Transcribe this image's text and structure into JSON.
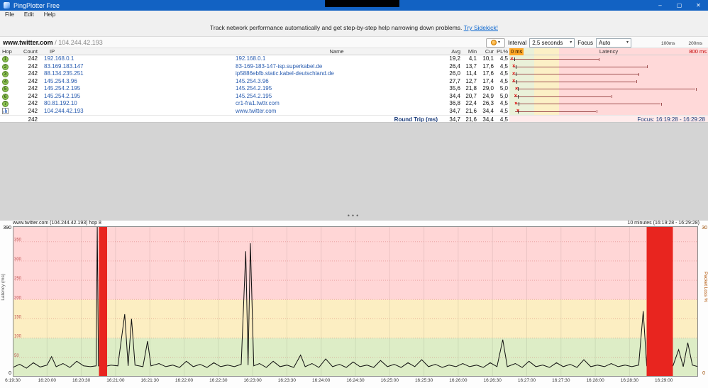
{
  "window": {
    "title": "PingPlotter Free",
    "menu": [
      "File",
      "Edit",
      "Help"
    ],
    "buttons": {
      "minimize": "–",
      "maximize": "▢",
      "close": "✕"
    }
  },
  "banner": {
    "text": "Track network performance automatically and get step-by-step help narrowing down problems.",
    "link": "Try Sidekick!"
  },
  "target": {
    "host": "www.twitter.com",
    "separator": "/",
    "ip": "104.244.42.193"
  },
  "controls": {
    "dropdown_glyph": "▾",
    "interval_label": "Interval",
    "interval_value": "2,5 seconds",
    "focus_label": "Focus",
    "focus_value": "Auto",
    "legend": {
      "label_100": "100ms",
      "label_200": "200ms"
    }
  },
  "table": {
    "x_marker": "×",
    "headers": {
      "hop": "Hop",
      "count": "Count",
      "ip": "IP",
      "name": "Name",
      "avg": "Avg",
      "min": "Min",
      "cur": "Cur",
      "pl": "PL%",
      "latency": "Latency",
      "scale_min": "0 ms",
      "scale_max": "800 ms"
    },
    "scale_max_ms": 800,
    "rows": [
      {
        "hop": "1",
        "count": "242",
        "ip": "192.168.0.1",
        "name": "192.168.0.1",
        "avg": "19,2",
        "min": "4,1",
        "cur": "10,1",
        "pl": "4,5",
        "min_ms": 4.1,
        "avg_ms": 19.2,
        "cur_ms": 10.1,
        "max_ms": 360
      },
      {
        "hop": "2",
        "count": "242",
        "ip": "83.169.183.147",
        "name": "83-169-183-147-isp.superkabel.de",
        "avg": "26,4",
        "min": "13,7",
        "cur": "17,6",
        "pl": "4,5",
        "min_ms": 13.7,
        "avg_ms": 26.4,
        "cur_ms": 17.6,
        "max_ms": 555
      },
      {
        "hop": "3",
        "count": "242",
        "ip": "88.134.235.251",
        "name": "ip5886ebfb.static.kabel-deutschland.de",
        "avg": "26,0",
        "min": "11,4",
        "cur": "17,6",
        "pl": "4,5",
        "min_ms": 11.4,
        "avg_ms": 26.0,
        "cur_ms": 17.6,
        "max_ms": 520
      },
      {
        "hop": "4",
        "count": "242",
        "ip": "145.254.3.96",
        "name": "145.254.3.96",
        "avg": "27,7",
        "min": "12,7",
        "cur": "17,4",
        "pl": "4,5",
        "min_ms": 12.7,
        "avg_ms": 27.7,
        "cur_ms": 17.4,
        "max_ms": 510
      },
      {
        "hop": "5",
        "count": "242",
        "ip": "145.254.2.195",
        "name": "145.254.2.195",
        "avg": "35,6",
        "min": "21,8",
        "cur": "29,0",
        "pl": "5,0",
        "min_ms": 21.8,
        "avg_ms": 35.6,
        "cur_ms": 29.0,
        "max_ms": 750
      },
      {
        "hop": "6",
        "count": "242",
        "ip": "145.254.2.195",
        "name": "145.254.2.195",
        "avg": "34,4",
        "min": "20,7",
        "cur": "24,9",
        "pl": "5,0",
        "min_ms": 20.7,
        "avg_ms": 34.4,
        "cur_ms": 24.9,
        "max_ms": 410
      },
      {
        "hop": "7",
        "count": "242",
        "ip": "80.81.192.10",
        "name": "cr1-fra1.twttr.com",
        "avg": "36,8",
        "min": "22,4",
        "cur": "26,3",
        "pl": "4,5",
        "min_ms": 22.4,
        "avg_ms": 36.8,
        "cur_ms": 26.3,
        "max_ms": 610
      },
      {
        "hop": "8",
        "count": "242",
        "ip": "104.244.42.193",
        "name": "www.twitter.com",
        "avg": "34,7",
        "min": "21,6",
        "cur": "34,4",
        "pl": "4,5",
        "min_ms": 21.6,
        "avg_ms": 34.7,
        "cur_ms": 34.4,
        "max_ms": 350,
        "icon": "graph"
      }
    ],
    "summary": {
      "count": "242",
      "label": "Round Trip (ms)",
      "avg": "34,7",
      "min": "21,6",
      "cur": "34,4",
      "pl": "4,5"
    },
    "focus_text": "Focus: 16:19:28 - 16:29:28"
  },
  "splitter": {
    "glyph": "•••"
  },
  "timeline": {
    "title_left": "www.twitter.com (104.244.42.193) hop 8",
    "title_right": "10 minutes (16:19:28 - 16:29:28)",
    "left_axis": {
      "label": "Latency (ms)",
      "top": "390",
      "bottom": "0"
    },
    "right_axis": {
      "label": "Packet Loss %",
      "top": "30",
      "bottom": "0"
    },
    "inner_ticks": [
      "350",
      "300",
      "250",
      "200",
      "150",
      "100",
      "50"
    ],
    "x_labels": [
      "6:19:30",
      "16:20:00",
      "16:20:30",
      "16:21:00",
      "16:21:30",
      "16:22:00",
      "16:22:30",
      "16:23:00",
      "16:23:30",
      "16:24:00",
      "16:24:30",
      "16:25:00",
      "16:25:30",
      "16:26:00",
      "16:26:30",
      "16:27:00",
      "16:27:30",
      "16:28:00",
      "16:28:30",
      "16:29:00"
    ]
  },
  "chart_data": {
    "type": "line",
    "title": "www.twitter.com (104.244.42.193) hop 8",
    "window": "10 minutes (16:19:28 - 16:29:28)",
    "x_unit": "seconds since 16:19:30",
    "xlim": [
      0,
      600
    ],
    "ylabel": "Latency (ms)",
    "ylim": [
      0,
      390
    ],
    "y2label": "Packet Loss %",
    "y2lim": [
      0,
      30
    ],
    "bands_ms": {
      "green": [
        0,
        100
      ],
      "yellow": [
        100,
        200
      ],
      "red": [
        200,
        390
      ]
    },
    "series": [
      {
        "name": "hop 8 latency (ms)",
        "points": [
          [
            0,
            24
          ],
          [
            6,
            32
          ],
          [
            12,
            22
          ],
          [
            18,
            36
          ],
          [
            24,
            25
          ],
          [
            30,
            30
          ],
          [
            34,
            52
          ],
          [
            38,
            26
          ],
          [
            44,
            34
          ],
          [
            50,
            24
          ],
          [
            56,
            40
          ],
          [
            62,
            28
          ],
          [
            68,
            26
          ],
          [
            73,
            28
          ],
          [
            74,
            390
          ],
          [
            75,
            28
          ],
          [
            80,
            26
          ],
          [
            86,
            30
          ],
          [
            92,
            28
          ],
          [
            98,
            162
          ],
          [
            101,
            28
          ],
          [
            104,
            150
          ],
          [
            107,
            30
          ],
          [
            114,
            26
          ],
          [
            118,
            92
          ],
          [
            121,
            28
          ],
          [
            128,
            34
          ],
          [
            134,
            26
          ],
          [
            140,
            30
          ],
          [
            146,
            24
          ],
          [
            152,
            40
          ],
          [
            158,
            26
          ],
          [
            164,
            32
          ],
          [
            170,
            24
          ],
          [
            176,
            36
          ],
          [
            182,
            26
          ],
          [
            188,
            30
          ],
          [
            194,
            26
          ],
          [
            200,
            32
          ],
          [
            204,
            325
          ],
          [
            206,
            30
          ],
          [
            208,
            346
          ],
          [
            211,
            28
          ],
          [
            216,
            34
          ],
          [
            222,
            24
          ],
          [
            228,
            40
          ],
          [
            234,
            26
          ],
          [
            240,
            30
          ],
          [
            246,
            24
          ],
          [
            252,
            56
          ],
          [
            256,
            26
          ],
          [
            262,
            34
          ],
          [
            268,
            24
          ],
          [
            274,
            46
          ],
          [
            280,
            26
          ],
          [
            286,
            32
          ],
          [
            292,
            24
          ],
          [
            298,
            38
          ],
          [
            304,
            26
          ],
          [
            310,
            30
          ],
          [
            316,
            24
          ],
          [
            322,
            42
          ],
          [
            328,
            26
          ],
          [
            334,
            32
          ],
          [
            340,
            24
          ],
          [
            346,
            36
          ],
          [
            352,
            26
          ],
          [
            358,
            44
          ],
          [
            364,
            26
          ],
          [
            370,
            32
          ],
          [
            376,
            24
          ],
          [
            382,
            30
          ],
          [
            388,
            26
          ],
          [
            394,
            34
          ],
          [
            400,
            26
          ],
          [
            406,
            30
          ],
          [
            412,
            24
          ],
          [
            418,
            36
          ],
          [
            424,
            26
          ],
          [
            429,
            96
          ],
          [
            433,
            26
          ],
          [
            440,
            34
          ],
          [
            446,
            24
          ],
          [
            452,
            40
          ],
          [
            458,
            26
          ],
          [
            464,
            30
          ],
          [
            470,
            24
          ],
          [
            476,
            36
          ],
          [
            482,
            26
          ],
          [
            488,
            32
          ],
          [
            494,
            24
          ],
          [
            500,
            44
          ],
          [
            506,
            26
          ],
          [
            512,
            30
          ],
          [
            518,
            26
          ],
          [
            524,
            34
          ],
          [
            530,
            26
          ],
          [
            536,
            30
          ],
          [
            542,
            26
          ],
          [
            548,
            30
          ],
          [
            552,
            170
          ],
          [
            555,
            28
          ],
          [
            560,
            26
          ],
          [
            566,
            30
          ],
          [
            572,
            26
          ],
          [
            578,
            28
          ],
          [
            583,
            70
          ],
          [
            587,
            26
          ],
          [
            591,
            88
          ],
          [
            595,
            30
          ],
          [
            600,
            26
          ]
        ]
      }
    ],
    "loss_bars": [
      {
        "start": 75.5,
        "end": 82.5
      },
      {
        "start": 555,
        "end": 578
      }
    ]
  },
  "colors": {
    "titlebar": "#1262c3",
    "link": "#0a66d0",
    "band_green": "#ddedc6",
    "band_yellow": "#fceec2",
    "band_red": "#ffd6d6",
    "loss_red": "#e8251f",
    "hop_badge": "#8cc152",
    "scale_chip_orange": "#ffa726"
  }
}
